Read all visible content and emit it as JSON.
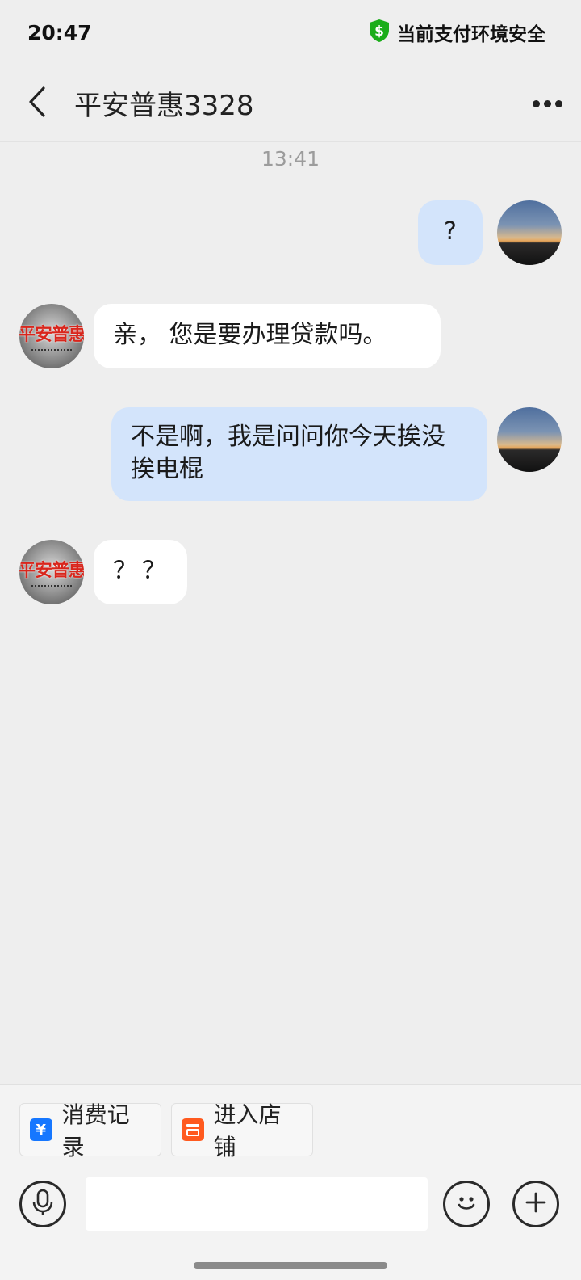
{
  "status_bar": {
    "time": "20:47",
    "security_text": "当前支付环境安全"
  },
  "header": {
    "title": "平安普惠3328"
  },
  "timestamp": "13:41",
  "messages": [
    {
      "from": "me",
      "text": "?"
    },
    {
      "from": "shop",
      "text": "亲， 您是要办理贷款吗。"
    },
    {
      "from": "me",
      "text": "不是啊，我是问问你今天挨没挨电棍"
    },
    {
      "from": "shop",
      "text": "？？"
    }
  ],
  "shop_avatar_text": "平安普惠",
  "quick_actions": [
    {
      "label": "消费记录",
      "icon": "yuan-card-icon",
      "color": "#1677ff"
    },
    {
      "label": "进入店铺",
      "icon": "store-icon",
      "color": "#ff5a1f"
    }
  ],
  "input": {
    "value": "",
    "placeholder": ""
  },
  "colors": {
    "outgoing_bubble": "#d3e4fb",
    "incoming_bubble": "#ffffff",
    "security_green": "#1aad19"
  }
}
